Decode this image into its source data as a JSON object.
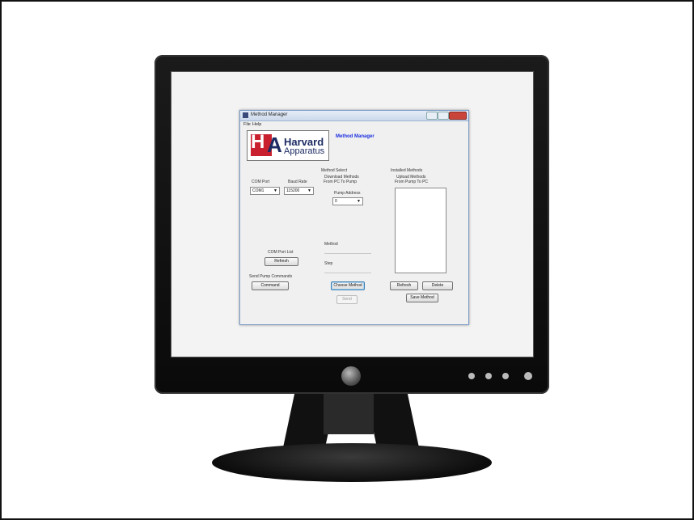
{
  "window": {
    "title": "Method Manager",
    "menu": [
      "File",
      "Help"
    ]
  },
  "logo": {
    "h": "H",
    "a": "A",
    "line1": "Harvard",
    "line2": "Apparatus"
  },
  "app_title": "Method Manager",
  "left": {
    "com_port": {
      "label": "COM Port",
      "value": "COM1"
    },
    "baud_rate": {
      "label": "Baud Rate",
      "value": "115200"
    },
    "com_port_list": {
      "label": "COM Port List",
      "button": "Refresh"
    },
    "send_pump_commands": {
      "label": "Send Pump Commands",
      "button": "Command"
    }
  },
  "method_select": {
    "group_label": "Method Select",
    "download_line1": "Download Methods",
    "download_line2": "From PC To Pump",
    "pump_address_label": "Pump Address",
    "pump_address_value": "0",
    "method_label": "Method",
    "step_label": "Step",
    "choose_button": "Choose Method",
    "send_button": "Send"
  },
  "installed_methods": {
    "group_label": "Installed Methods",
    "upload_line1": "Upload Methods",
    "upload_line2": "From Pump To PC",
    "refresh_button": "Refresh",
    "delete_button": "Delete",
    "save_button": "Save Method"
  },
  "colors": {
    "accent_title": "#1a2ee0",
    "logo_red": "#c9202f",
    "logo_navy": "#1c2b63"
  }
}
